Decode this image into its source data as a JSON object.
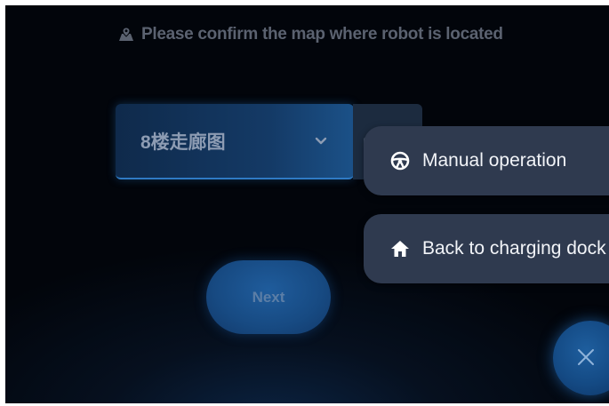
{
  "prompt": {
    "icon": "map-pin-icon",
    "text": "Please confirm the map where robot is located"
  },
  "map_select": {
    "selected_value": "8楼走廊图",
    "icon": "chevron-down-icon"
  },
  "next_button": {
    "label": "Next"
  },
  "action_menu": {
    "items": [
      {
        "label": "Manual operation",
        "icon": "steering-wheel-icon"
      },
      {
        "label": "Back to charging dock",
        "icon": "home-icon"
      }
    ]
  },
  "close_button": {
    "icon": "close-icon"
  },
  "colors": {
    "background": "#02050b",
    "select_fill": "#143a66",
    "menu_fill": "#2f3a4f",
    "accent_blue": "#1f5c9c",
    "muted_text": "#5b6270"
  }
}
